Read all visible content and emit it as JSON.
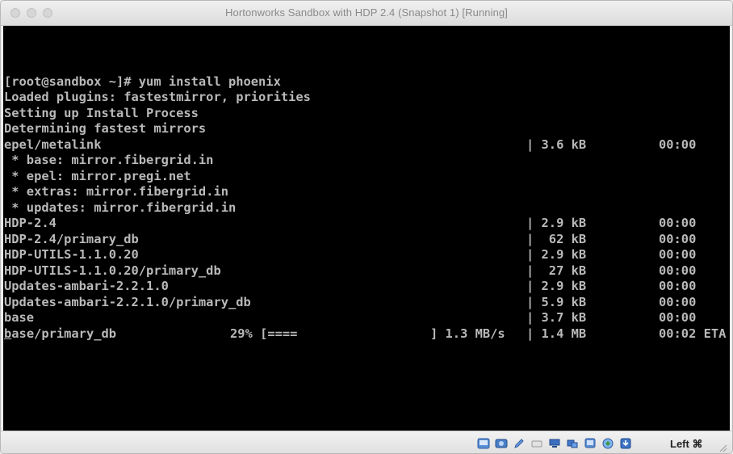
{
  "window": {
    "title": "Hortonworks Sandbox with HDP 2.4 (Snapshot 1) [Running]"
  },
  "terminal": {
    "lines": [
      {
        "c1": "[root@sandbox ~]# yum install phoenix"
      },
      {
        "c1": "Loaded plugins: fastestmirror, priorities"
      },
      {
        "c1": "Setting up Install Process"
      },
      {
        "c1": "Determining fastest mirrors"
      },
      {
        "c1": "epel/metalink",
        "c4": "| 3.6 kB",
        "c5": "00:00"
      },
      {
        "c1": " * base: mirror.fibergrid.in"
      },
      {
        "c1": " * epel: mirror.pregi.net"
      },
      {
        "c1": " * extras: mirror.fibergrid.in"
      },
      {
        "c1": " * updates: mirror.fibergrid.in"
      },
      {
        "c1": "HDP-2.4",
        "c4": "| 2.9 kB",
        "c5": "00:00"
      },
      {
        "c1": "HDP-2.4/primary_db",
        "c4": "|  62 kB",
        "c5": "00:00"
      },
      {
        "c1": "HDP-UTILS-1.1.0.20",
        "c4": "| 2.9 kB",
        "c5": "00:00"
      },
      {
        "c1": "HDP-UTILS-1.1.0.20/primary_db",
        "c4": "|  27 kB",
        "c5": "00:00"
      },
      {
        "c1": "Updates-ambari-2.2.1.0",
        "c4": "| 2.9 kB",
        "c5": "00:00"
      },
      {
        "c1": "Updates-ambari-2.2.1.0/primary_db",
        "c4": "| 5.9 kB",
        "c5": "00:00"
      },
      {
        "c1": "base",
        "c4": "| 3.7 kB",
        "c5": "00:00"
      }
    ],
    "progress_line": {
      "first_char": "b",
      "rest": "ase/primary_db",
      "percent": "29% [====",
      "rate": "] 1.3 MB/s",
      "size": "| 1.4 MB",
      "eta": "00:02 ETA"
    }
  },
  "statusbar": {
    "icons": [
      "hard-disk-icon",
      "optical-drive-icon",
      "pencil-icon",
      "usb-icon",
      "network-icon",
      "shared-folders-icon",
      "display-icon",
      "video-capture-icon",
      "mouse-integration-icon",
      "keyboard-icon"
    ],
    "host_key": "Left ⌘"
  }
}
